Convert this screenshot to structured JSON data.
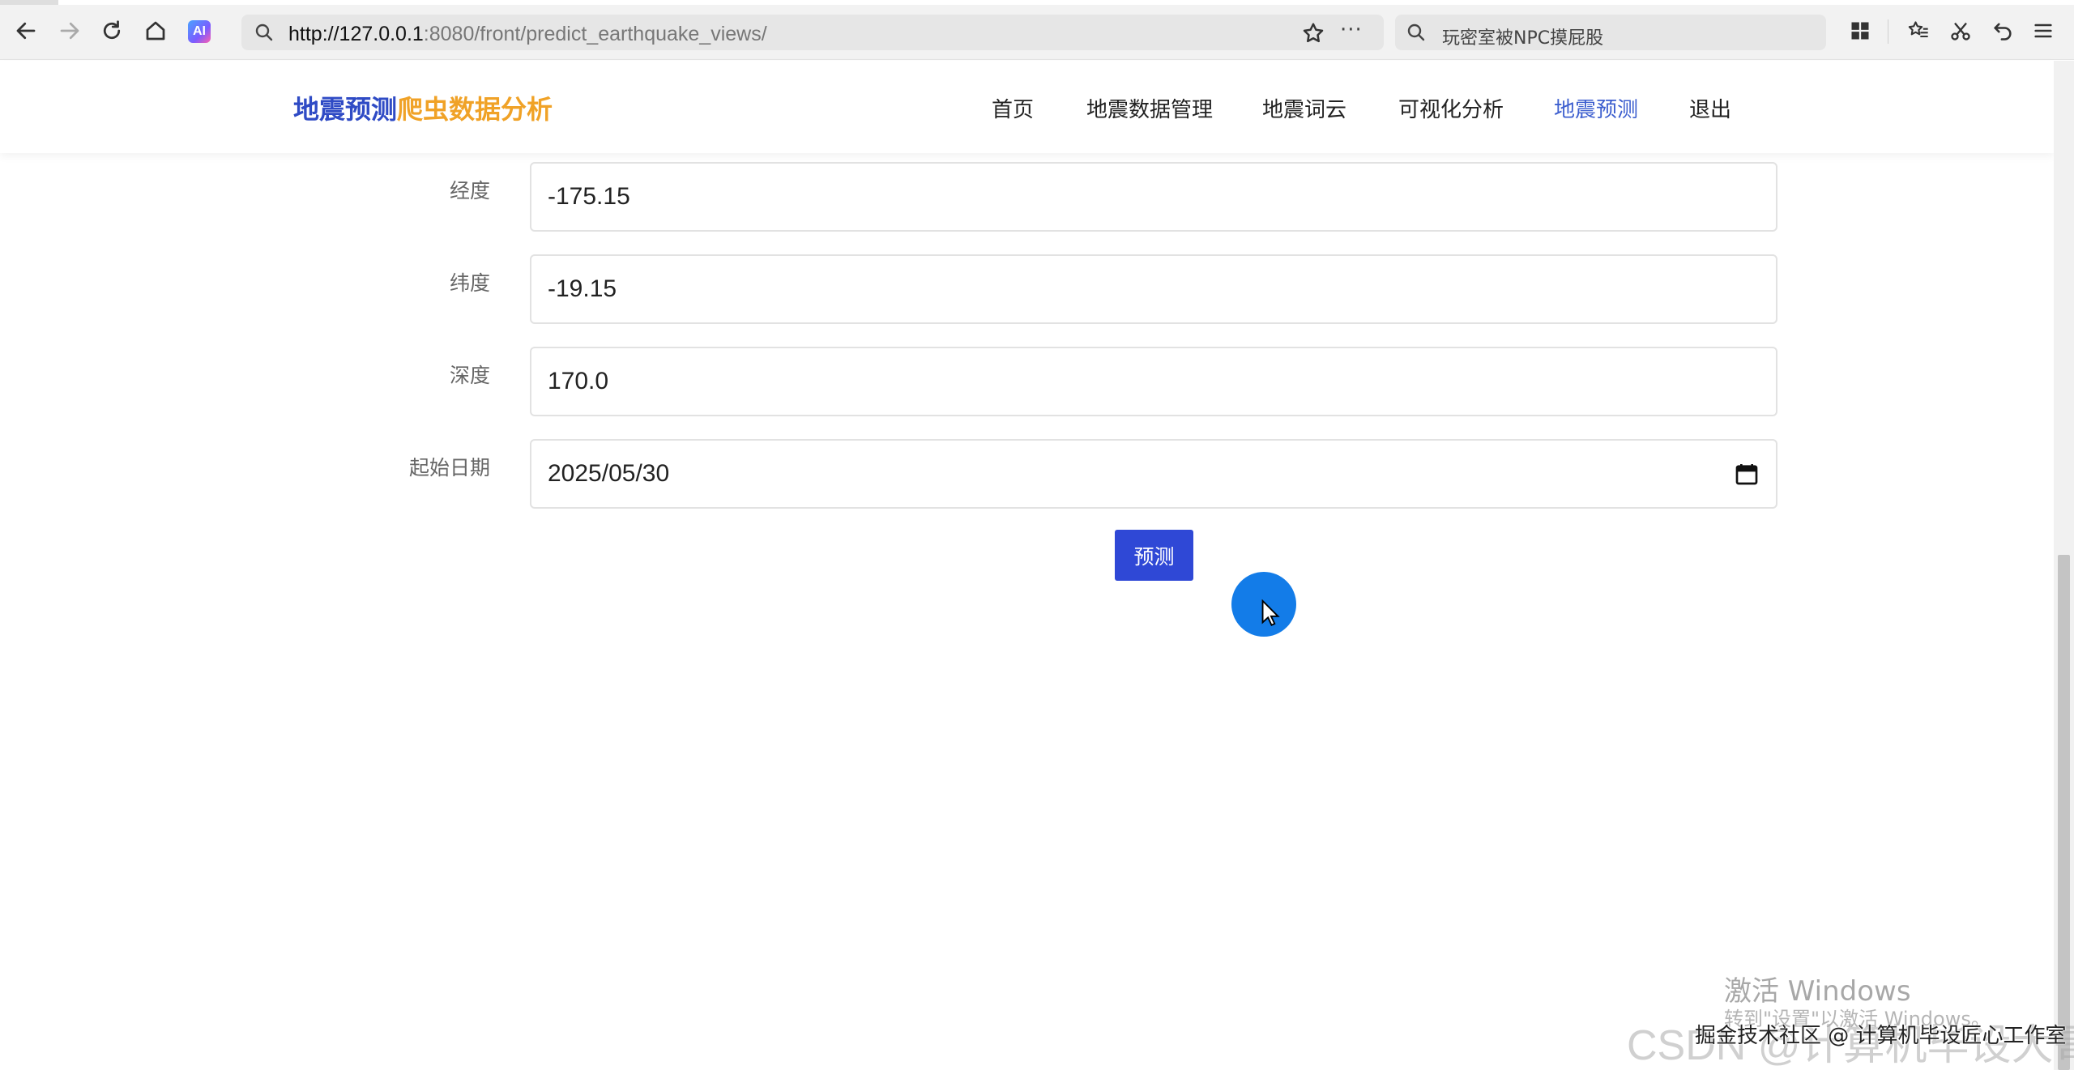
{
  "browser": {
    "url_host": "http://127.0.0.1",
    "url_rest": ":8080/front/predict_earthquake_views/",
    "ai_badge": "AI",
    "search_hint": "玩密室被NPC摸屁股",
    "icons": {
      "back": "arrow-left-icon",
      "forward": "arrow-right-icon",
      "reload": "reload-icon",
      "home": "home-icon",
      "bookmark": "star-icon",
      "more": "more-icon",
      "apps": "apps-grid-icon",
      "favorites": "favorites-icon",
      "screenshot": "scissors-icon",
      "undo": "undo-icon",
      "menu": "hamburger-menu-icon"
    },
    "more_glyph": "···"
  },
  "header": {
    "logo_part1": "地震预测",
    "logo_part2": "爬虫数据分析",
    "nav": [
      {
        "label": "首页"
      },
      {
        "label": "地震数据管理"
      },
      {
        "label": "地震词云"
      },
      {
        "label": "可视化分析"
      },
      {
        "label": "地震预测",
        "active": true
      },
      {
        "label": "退出"
      }
    ]
  },
  "form": {
    "longitude": {
      "label": "经度",
      "value": "-175.15"
    },
    "latitude": {
      "label": "纬度",
      "value": "-19.15"
    },
    "depth": {
      "label": "深度",
      "value": "170.0"
    },
    "start_date": {
      "label": "起始日期",
      "value": "2025/05/30"
    },
    "submit_label": "预测"
  },
  "watermarks": {
    "windows_title": "激活 Windows",
    "windows_sub": "转到\"设置\"以激活 Windows。",
    "csdn": "CSDN @计算机毕设大哥",
    "juejin": "掘金技术社区 @ 计算机毕设匠心工作室"
  },
  "colors": {
    "accent": "#2f48d6",
    "logo_blue": "#2f4bc5",
    "logo_orange": "#f0a227",
    "nav_active": "#3d5fcf",
    "click_indicator": "#137ce8"
  }
}
